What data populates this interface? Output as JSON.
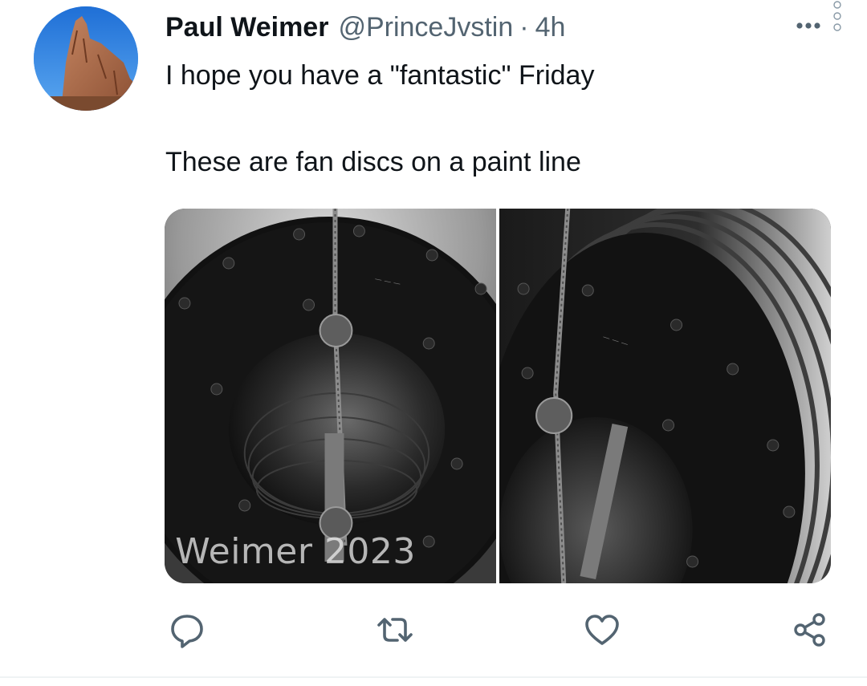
{
  "tweet": {
    "author_name": "Paul Weimer",
    "handle": "@PrinceJvstin",
    "separator": "·",
    "time": "4h",
    "text_line1": "I hope you have a \"fantastic\" Friday",
    "text_line2": "These are fan discs on a paint line",
    "media": {
      "photo_count": 2,
      "watermark": "l Weimer 2023"
    },
    "actions": [
      "reply-icon",
      "retweet-icon",
      "like-icon",
      "share-icon"
    ]
  },
  "colors": {
    "text_primary": "#0f1419",
    "text_secondary": "#536471",
    "divider": "#eff3f4"
  }
}
